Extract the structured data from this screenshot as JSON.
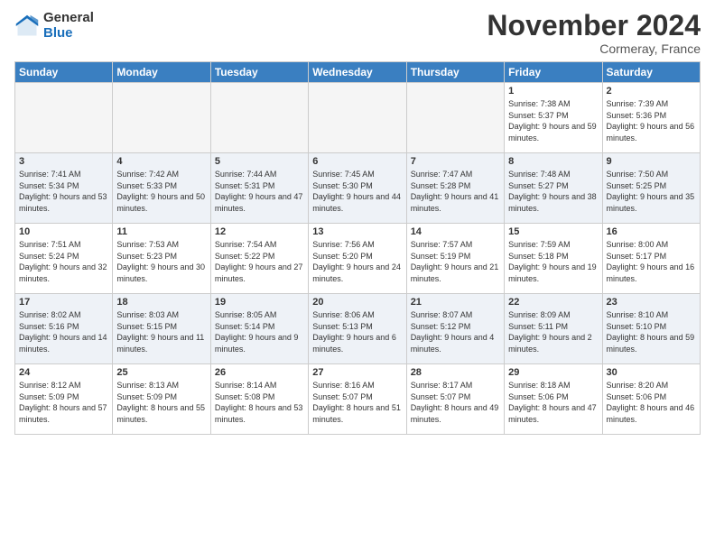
{
  "logo": {
    "general": "General",
    "blue": "Blue"
  },
  "header": {
    "title": "November 2024",
    "subtitle": "Cormeray, France"
  },
  "weekdays": [
    "Sunday",
    "Monday",
    "Tuesday",
    "Wednesday",
    "Thursday",
    "Friday",
    "Saturday"
  ],
  "weeks": [
    [
      {
        "day": "",
        "info": ""
      },
      {
        "day": "",
        "info": ""
      },
      {
        "day": "",
        "info": ""
      },
      {
        "day": "",
        "info": ""
      },
      {
        "day": "",
        "info": ""
      },
      {
        "day": "1",
        "info": "Sunrise: 7:38 AM\nSunset: 5:37 PM\nDaylight: 9 hours and 59 minutes."
      },
      {
        "day": "2",
        "info": "Sunrise: 7:39 AM\nSunset: 5:36 PM\nDaylight: 9 hours and 56 minutes."
      }
    ],
    [
      {
        "day": "3",
        "info": "Sunrise: 7:41 AM\nSunset: 5:34 PM\nDaylight: 9 hours and 53 minutes."
      },
      {
        "day": "4",
        "info": "Sunrise: 7:42 AM\nSunset: 5:33 PM\nDaylight: 9 hours and 50 minutes."
      },
      {
        "day": "5",
        "info": "Sunrise: 7:44 AM\nSunset: 5:31 PM\nDaylight: 9 hours and 47 minutes."
      },
      {
        "day": "6",
        "info": "Sunrise: 7:45 AM\nSunset: 5:30 PM\nDaylight: 9 hours and 44 minutes."
      },
      {
        "day": "7",
        "info": "Sunrise: 7:47 AM\nSunset: 5:28 PM\nDaylight: 9 hours and 41 minutes."
      },
      {
        "day": "8",
        "info": "Sunrise: 7:48 AM\nSunset: 5:27 PM\nDaylight: 9 hours and 38 minutes."
      },
      {
        "day": "9",
        "info": "Sunrise: 7:50 AM\nSunset: 5:25 PM\nDaylight: 9 hours and 35 minutes."
      }
    ],
    [
      {
        "day": "10",
        "info": "Sunrise: 7:51 AM\nSunset: 5:24 PM\nDaylight: 9 hours and 32 minutes."
      },
      {
        "day": "11",
        "info": "Sunrise: 7:53 AM\nSunset: 5:23 PM\nDaylight: 9 hours and 30 minutes."
      },
      {
        "day": "12",
        "info": "Sunrise: 7:54 AM\nSunset: 5:22 PM\nDaylight: 9 hours and 27 minutes."
      },
      {
        "day": "13",
        "info": "Sunrise: 7:56 AM\nSunset: 5:20 PM\nDaylight: 9 hours and 24 minutes."
      },
      {
        "day": "14",
        "info": "Sunrise: 7:57 AM\nSunset: 5:19 PM\nDaylight: 9 hours and 21 minutes."
      },
      {
        "day": "15",
        "info": "Sunrise: 7:59 AM\nSunset: 5:18 PM\nDaylight: 9 hours and 19 minutes."
      },
      {
        "day": "16",
        "info": "Sunrise: 8:00 AM\nSunset: 5:17 PM\nDaylight: 9 hours and 16 minutes."
      }
    ],
    [
      {
        "day": "17",
        "info": "Sunrise: 8:02 AM\nSunset: 5:16 PM\nDaylight: 9 hours and 14 minutes."
      },
      {
        "day": "18",
        "info": "Sunrise: 8:03 AM\nSunset: 5:15 PM\nDaylight: 9 hours and 11 minutes."
      },
      {
        "day": "19",
        "info": "Sunrise: 8:05 AM\nSunset: 5:14 PM\nDaylight: 9 hours and 9 minutes."
      },
      {
        "day": "20",
        "info": "Sunrise: 8:06 AM\nSunset: 5:13 PM\nDaylight: 9 hours and 6 minutes."
      },
      {
        "day": "21",
        "info": "Sunrise: 8:07 AM\nSunset: 5:12 PM\nDaylight: 9 hours and 4 minutes."
      },
      {
        "day": "22",
        "info": "Sunrise: 8:09 AM\nSunset: 5:11 PM\nDaylight: 9 hours and 2 minutes."
      },
      {
        "day": "23",
        "info": "Sunrise: 8:10 AM\nSunset: 5:10 PM\nDaylight: 8 hours and 59 minutes."
      }
    ],
    [
      {
        "day": "24",
        "info": "Sunrise: 8:12 AM\nSunset: 5:09 PM\nDaylight: 8 hours and 57 minutes."
      },
      {
        "day": "25",
        "info": "Sunrise: 8:13 AM\nSunset: 5:09 PM\nDaylight: 8 hours and 55 minutes."
      },
      {
        "day": "26",
        "info": "Sunrise: 8:14 AM\nSunset: 5:08 PM\nDaylight: 8 hours and 53 minutes."
      },
      {
        "day": "27",
        "info": "Sunrise: 8:16 AM\nSunset: 5:07 PM\nDaylight: 8 hours and 51 minutes."
      },
      {
        "day": "28",
        "info": "Sunrise: 8:17 AM\nSunset: 5:07 PM\nDaylight: 8 hours and 49 minutes."
      },
      {
        "day": "29",
        "info": "Sunrise: 8:18 AM\nSunset: 5:06 PM\nDaylight: 8 hours and 47 minutes."
      },
      {
        "day": "30",
        "info": "Sunrise: 8:20 AM\nSunset: 5:06 PM\nDaylight: 8 hours and 46 minutes."
      }
    ]
  ]
}
